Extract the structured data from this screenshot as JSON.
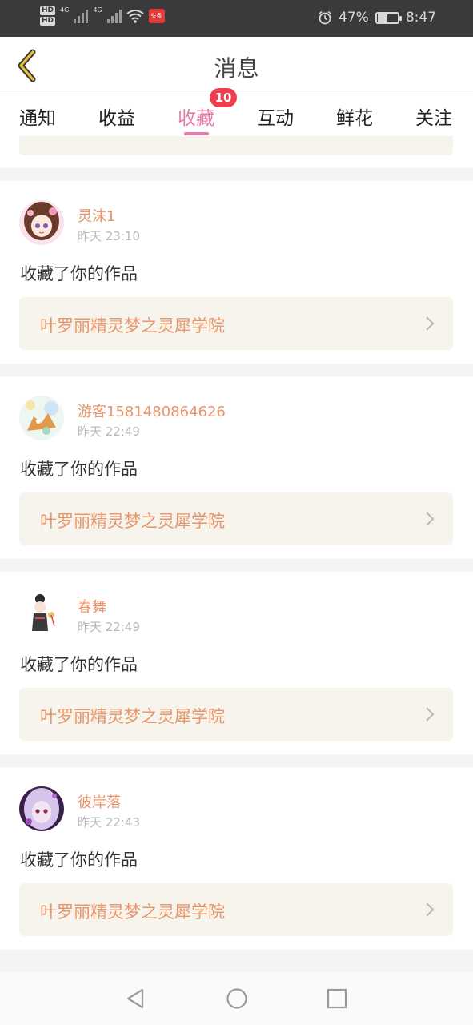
{
  "status_bar": {
    "left_tags": [
      "HD",
      "HD"
    ],
    "network": "4G",
    "network2": "4G",
    "news_badge": "头条",
    "battery_percent": "47%",
    "battery_level": 0.47,
    "time": "8:47"
  },
  "header": {
    "title": "消息",
    "back_icon": "chevron-left-icon"
  },
  "tabs": [
    {
      "label": "通知",
      "active": false
    },
    {
      "label": "收益",
      "active": false
    },
    {
      "label": "收藏",
      "active": true
    },
    {
      "label": "互动",
      "active": false
    },
    {
      "label": "鲜花",
      "active": false
    },
    {
      "label": "关注",
      "active": false
    }
  ],
  "tab_badge": "10",
  "colors": {
    "accent_pink": "#e87aa8",
    "username_orange": "#e8956a",
    "badge_red": "#ee3e4e",
    "link_bg": "#f6f4ec"
  },
  "messages": [
    {
      "username": "灵沫1",
      "time": "昨天 23:10",
      "action": "收藏了你的作品",
      "work_title": "叶罗丽精灵梦之灵犀学院"
    },
    {
      "username": "游客1581480864626",
      "time": "昨天 22:49",
      "action": "收藏了你的作品",
      "work_title": "叶罗丽精灵梦之灵犀学院"
    },
    {
      "username": "春舞",
      "time": "昨天 22:49",
      "action": "收藏了你的作品",
      "work_title": "叶罗丽精灵梦之灵犀学院"
    },
    {
      "username": "彼岸落",
      "time": "昨天 22:43",
      "action": "收藏了你的作品",
      "work_title": "叶罗丽精灵梦之灵犀学院"
    }
  ],
  "navbar": {
    "back_icon": "triangle-back-icon",
    "home_icon": "circle-home-icon",
    "recents_icon": "square-recents-icon"
  }
}
